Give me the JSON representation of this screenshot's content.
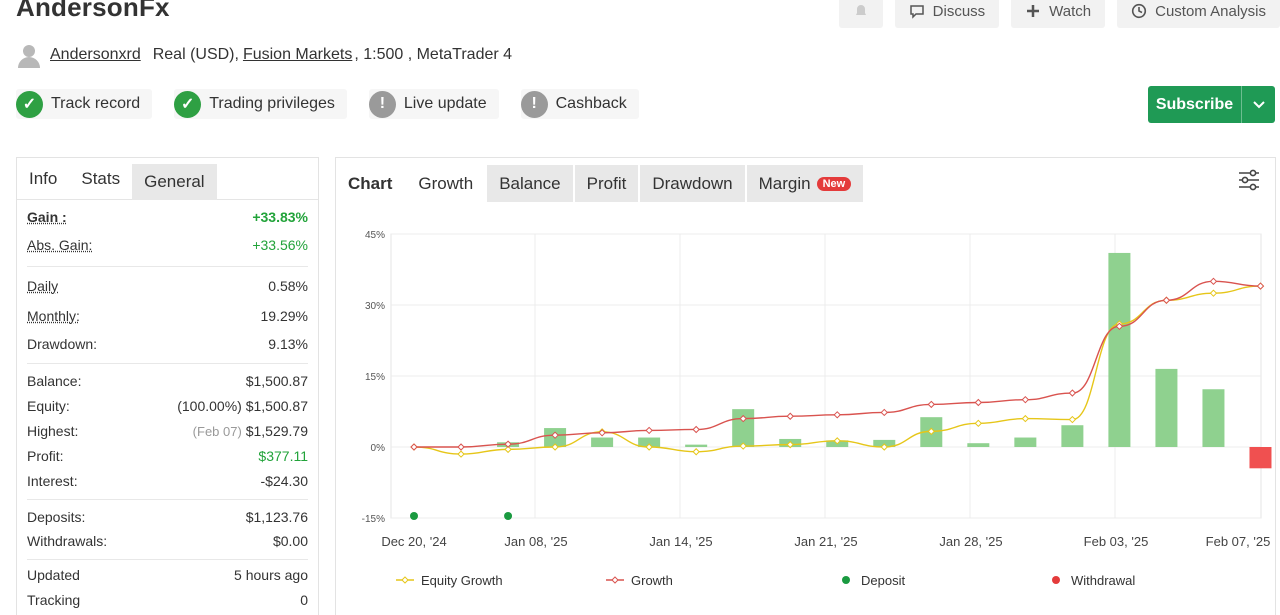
{
  "header": {
    "title": "AndersonFx",
    "actions": [
      {
        "label": "",
        "icon": "bell-icon"
      },
      {
        "label": "Discuss",
        "icon": "comment-icon"
      },
      {
        "label": "Watch",
        "icon": "plus-icon"
      },
      {
        "label": "Custom Analysis",
        "icon": "clock-icon"
      }
    ],
    "owner": "Andersonxrd",
    "account_type": "Real (USD),",
    "broker": "Fusion Markets",
    "leverage": ", 1:500 , MetaTrader 4"
  },
  "badges": [
    {
      "label": "Track record",
      "status": "ok"
    },
    {
      "label": "Trading privileges",
      "status": "ok"
    },
    {
      "label": "Live update",
      "status": "warn"
    },
    {
      "label": "Cashback",
      "status": "warn"
    }
  ],
  "subscribe": {
    "label": "Subscribe"
  },
  "left_tabs": [
    "Info",
    "Stats",
    "General"
  ],
  "stats": {
    "gain": {
      "label": "Gain :",
      "value": "+33.83%"
    },
    "abs_gain": {
      "label": "Abs. Gain:",
      "value": "+33.56%"
    },
    "daily": {
      "label": "Daily",
      "value": "0.58%"
    },
    "monthly": {
      "label": "Monthly:",
      "value": "19.29%"
    },
    "drawdown": {
      "label": "Drawdown:",
      "value": "9.13%"
    },
    "balance": {
      "label": "Balance:",
      "value": "$1,500.87"
    },
    "equity": {
      "label": "Equity:",
      "prefix": "(100.00%)",
      "value": "$1,500.87"
    },
    "highest": {
      "label": "Highest:",
      "prefix": "(Feb 07)",
      "value": "$1,529.79"
    },
    "profit": {
      "label": "Profit:",
      "value": "$377.11"
    },
    "interest": {
      "label": "Interest:",
      "value": "-$24.30"
    },
    "deposits": {
      "label": "Deposits:",
      "value": "$1,123.76"
    },
    "withdrawals": {
      "label": "Withdrawals:",
      "value": "$0.00"
    },
    "updated": {
      "label": "Updated",
      "value": "5 hours ago"
    },
    "tracking": {
      "label": "Tracking",
      "value": "0"
    }
  },
  "chart_tabs": [
    {
      "label": "Chart",
      "style": "plain"
    },
    {
      "label": "Growth",
      "style": "white"
    },
    {
      "label": "Balance",
      "style": "gray"
    },
    {
      "label": "Profit",
      "style": "gray"
    },
    {
      "label": "Drawdown",
      "style": "gray"
    },
    {
      "label": "Margin",
      "style": "gray",
      "badge": "New"
    }
  ],
  "colors": {
    "green": "#1f9a55",
    "bar_pos": "#8fd18f",
    "bar_neg": "#f05050",
    "growth": "#d9534f",
    "equity": "#e6c619"
  },
  "chart_data": {
    "type": "bar",
    "y_ticks": [
      "45%",
      "30%",
      "15%",
      "0%",
      "-15%"
    ],
    "ylim": [
      -15,
      45
    ],
    "x_ticks": [
      "Dec 20, '24",
      "Jan 08, '25",
      "Jan 14, '25",
      "Jan 21, '25",
      "Jan 28, '25",
      "Feb 03, '25",
      "Feb 07, '25"
    ],
    "bars": [
      0,
      0,
      1.0,
      4.0,
      2.0,
      2.0,
      0.5,
      8.0,
      1.7,
      1.4,
      1.5,
      6.3,
      0.8,
      2.0,
      4.6,
      41.0,
      16.5,
      12.2,
      -4.5
    ],
    "series": [
      {
        "name": "Growth",
        "values": [
          0,
          0,
          0.6,
          2.5,
          3.0,
          3.5,
          3.7,
          6.0,
          6.5,
          6.8,
          7.3,
          9.0,
          9.4,
          10.0,
          11.4,
          25.5,
          31.0,
          35.0,
          34.0
        ]
      },
      {
        "name": "Equity Growth",
        "values": [
          0,
          -1.5,
          -0.5,
          0,
          3.2,
          0,
          -1.0,
          0.2,
          0.5,
          1.3,
          0.0,
          3.3,
          5.0,
          6.0,
          5.8,
          26.0,
          31.0,
          32.5,
          34.0
        ]
      }
    ],
    "deposits": [
      0,
      2
    ],
    "legend": [
      {
        "label": "Equity Growth",
        "marker": "line-yellow"
      },
      {
        "label": "Growth",
        "marker": "line-red"
      },
      {
        "label": "Deposit",
        "marker": "dot-green"
      },
      {
        "label": "Withdrawal",
        "marker": "dot-red"
      }
    ]
  }
}
